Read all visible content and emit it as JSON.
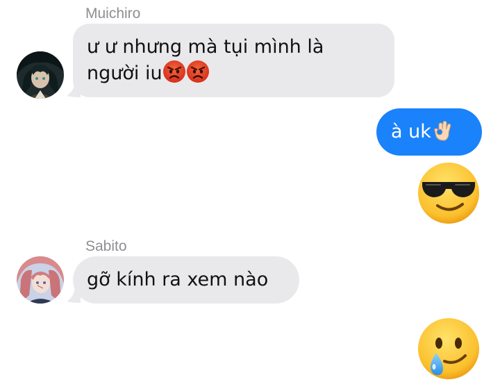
{
  "messages": [
    {
      "sender": "Muichiro",
      "direction": "incoming",
      "avatar_icon": "muichiro-avatar",
      "text_line1": "ư ư nhưng mà tụi mình là",
      "text_line2": "người iu",
      "emoji": [
        "angry-face-icon",
        "angry-face-icon"
      ]
    },
    {
      "direction": "outgoing",
      "text": "à uk",
      "emoji": "ok-hand-icon"
    },
    {
      "direction": "outgoing",
      "emoji": "sunglasses-face-icon"
    },
    {
      "sender": "Sabito",
      "direction": "incoming",
      "avatar_icon": "sabito-avatar",
      "text": "gỡ kính ra xem nào"
    },
    {
      "direction": "outgoing",
      "emoji": "smiling-face-with-tear-icon"
    }
  ],
  "colors": {
    "incoming_bubble": "#e9e9eb",
    "outgoing_bubble": "#1a82fb",
    "sender_name": "#8e8e93"
  }
}
